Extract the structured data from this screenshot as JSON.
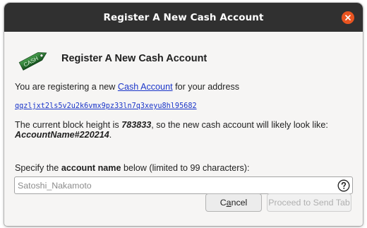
{
  "window": {
    "title": "Register A New Cash Account"
  },
  "header": {
    "icon": "cash-tag-icon",
    "tag_text": "CASH",
    "heading": "Register A New Cash Account"
  },
  "intro": {
    "prefix": "You are registering a new ",
    "link": "Cash Account",
    "suffix": " for your address"
  },
  "address": "qqzljxt2ls5v2u2k6vmx9pz33ln7q3xeyu8hl95682",
  "block_info": {
    "prefix": "The current block height is ",
    "height": "783833",
    "middle": ", so the new cash account will likely look like:",
    "example": "AccountName#220214",
    "end": "."
  },
  "specify": {
    "prefix": "Specify the ",
    "bold": "account name",
    "suffix": " below (limited to 99 characters):"
  },
  "name_input": {
    "value": "",
    "placeholder": "Satoshi_Nakamoto",
    "help_icon": "question-circle-icon"
  },
  "buttons": {
    "cancel_prefix": "C",
    "cancel_mnemonic": "a",
    "cancel_suffix": "ncel",
    "proceed": "Proceed to Send Tab"
  },
  "colors": {
    "titlebar": "#303030",
    "close_button": "#e95420",
    "link": "#1a35c9",
    "tag": "#2e7d32"
  }
}
